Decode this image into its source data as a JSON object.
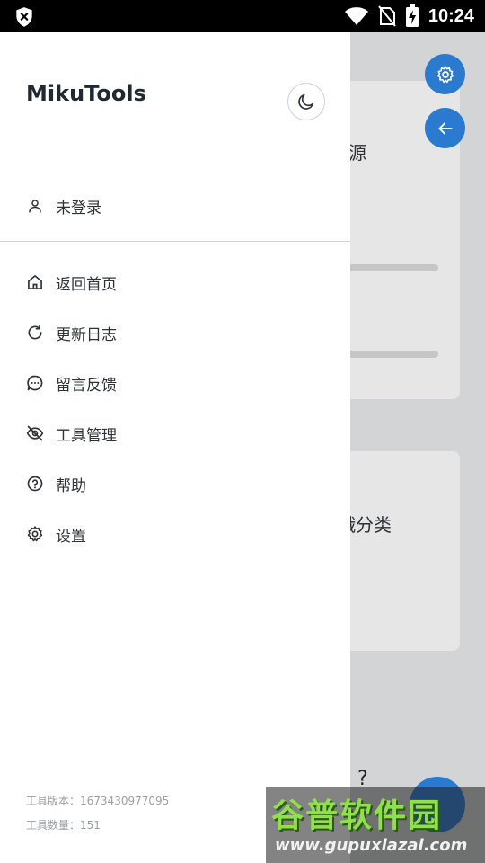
{
  "status_bar": {
    "time": "10:24",
    "icons": [
      "shield-close-icon",
      "wifi-icon",
      "no-sim-icon",
      "battery-charging-icon"
    ]
  },
  "background": {
    "card1_text": "源",
    "card2_text": "娥分类",
    "help_text": "?",
    "fab_icons": [
      "gear-icon",
      "arrow-left-icon"
    ]
  },
  "drawer": {
    "title": "MikuTools",
    "theme_icon": "moon-icon",
    "user": {
      "label": "未登录",
      "icon": "user-icon"
    },
    "menu": [
      {
        "label": "返回首页",
        "icon": "home-icon"
      },
      {
        "label": "更新日志",
        "icon": "refresh-icon"
      },
      {
        "label": "留言反馈",
        "icon": "chat-icon"
      },
      {
        "label": "工具管理",
        "icon": "eye-off-icon"
      },
      {
        "label": "帮助",
        "icon": "help-circle-icon"
      },
      {
        "label": "设置",
        "icon": "gear-icon"
      }
    ],
    "footer": {
      "version_label": "工具版本：",
      "version_value": "1673430977095",
      "count_label": "工具数量：",
      "count_value": "151"
    }
  },
  "watermark": {
    "title": "谷普软件园",
    "url": "www.gupuxiazai.com"
  },
  "colors": {
    "accent": "#2a7ad0",
    "overlay": "#d3d4d6",
    "text": "#2f3338",
    "muted": "#9aa0a6"
  }
}
